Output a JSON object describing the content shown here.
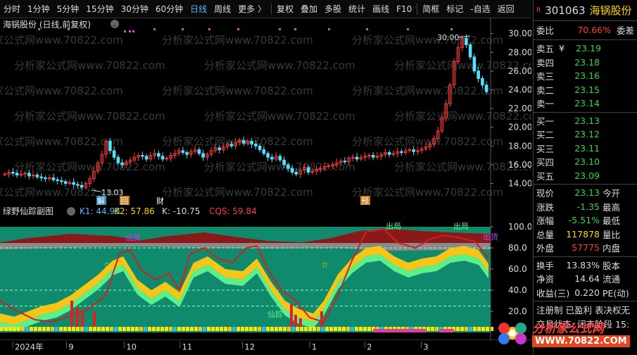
{
  "toolbar": {
    "items": [
      "分时",
      "1分钟",
      "5分钟",
      "15分钟",
      "30分钟",
      "60分钟",
      "日线",
      "周线",
      "更多 〉",
      "复权",
      "叠加",
      "多股",
      "统计",
      "画线",
      "F10",
      "简框",
      "标记",
      "-自选",
      "返回"
    ],
    "active": "日线"
  },
  "main": {
    "title": "海锅股份 (日线,前复权)",
    "high_label": "30.00",
    "low_label": "13.03",
    "markers": [
      "解",
      "回",
      "财",
      "预"
    ],
    "y_ticks": [
      "30.00",
      "28.00",
      "26.00",
      "24.00",
      "22.00",
      "20.00",
      "18.00",
      "16.00",
      "14.00"
    ],
    "watermark": "分析家公式网www.70822.com"
  },
  "indicator": {
    "name": "绿野仙踪副图",
    "k1_label": "K1: 44.93",
    "k2_label": "K2: 57.86",
    "k_label": "K: -10.75",
    "cqs_label": "CQS: 59.84",
    "y_ticks": [
      "100.0",
      "80.0",
      "60.0",
      "40.0",
      "20.0"
    ],
    "annotations": {
      "chuhuo": "出货",
      "chuju": "出局",
      "genzong": "仙踪"
    }
  },
  "xaxis": {
    "labels": [
      "2024年",
      "9",
      "10",
      "11",
      "12",
      "1",
      "2",
      "3"
    ]
  },
  "panel": {
    "r_badge": "R",
    "code": "301063",
    "name": "海锅股份",
    "weibi_label": "委比",
    "weibi": "70.66%",
    "weicha_label": "委差",
    "asks": [
      {
        "l": "卖五",
        "v": "23.19",
        "yen": "¥"
      },
      {
        "l": "卖四",
        "v": "23.18"
      },
      {
        "l": "卖三",
        "v": "23.16"
      },
      {
        "l": "卖二",
        "v": "23.15"
      },
      {
        "l": "卖一",
        "v": "23.14"
      }
    ],
    "bids": [
      {
        "l": "买一",
        "v": "23.13"
      },
      {
        "l": "买二",
        "v": "23.12"
      },
      {
        "l": "买三",
        "v": "23.11"
      },
      {
        "l": "买四",
        "v": "23.10"
      },
      {
        "l": "买五",
        "v": "23.09"
      }
    ],
    "stats": [
      {
        "l": "现价",
        "v": "23.13",
        "c": "g",
        "x": "今开"
      },
      {
        "l": "涨跌",
        "v": "-1.35",
        "c": "g",
        "x": "最高"
      },
      {
        "l": "涨幅",
        "v": "-5.51%",
        "c": "g",
        "x": "最低"
      },
      {
        "l": "总量",
        "v": "117878",
        "c": "y",
        "x": "量比"
      },
      {
        "l": "外盘",
        "v": "57775",
        "c": "r",
        "x": "内盘"
      }
    ],
    "stats2": [
      {
        "l": "换手",
        "v": "13.83%",
        "x": "股本"
      },
      {
        "l": "净资",
        "v": "14.64",
        "x": "流通"
      },
      {
        "l": "收益(三)",
        "v": "0.220",
        "x": "PE(动)"
      }
    ],
    "reg": "注册制 已盈利 表决权无",
    "status": "交易状态: 闭市阶段 15:",
    "logo_text": "分析家公式网",
    "logo_url": "WWW.70822.COM"
  }
}
